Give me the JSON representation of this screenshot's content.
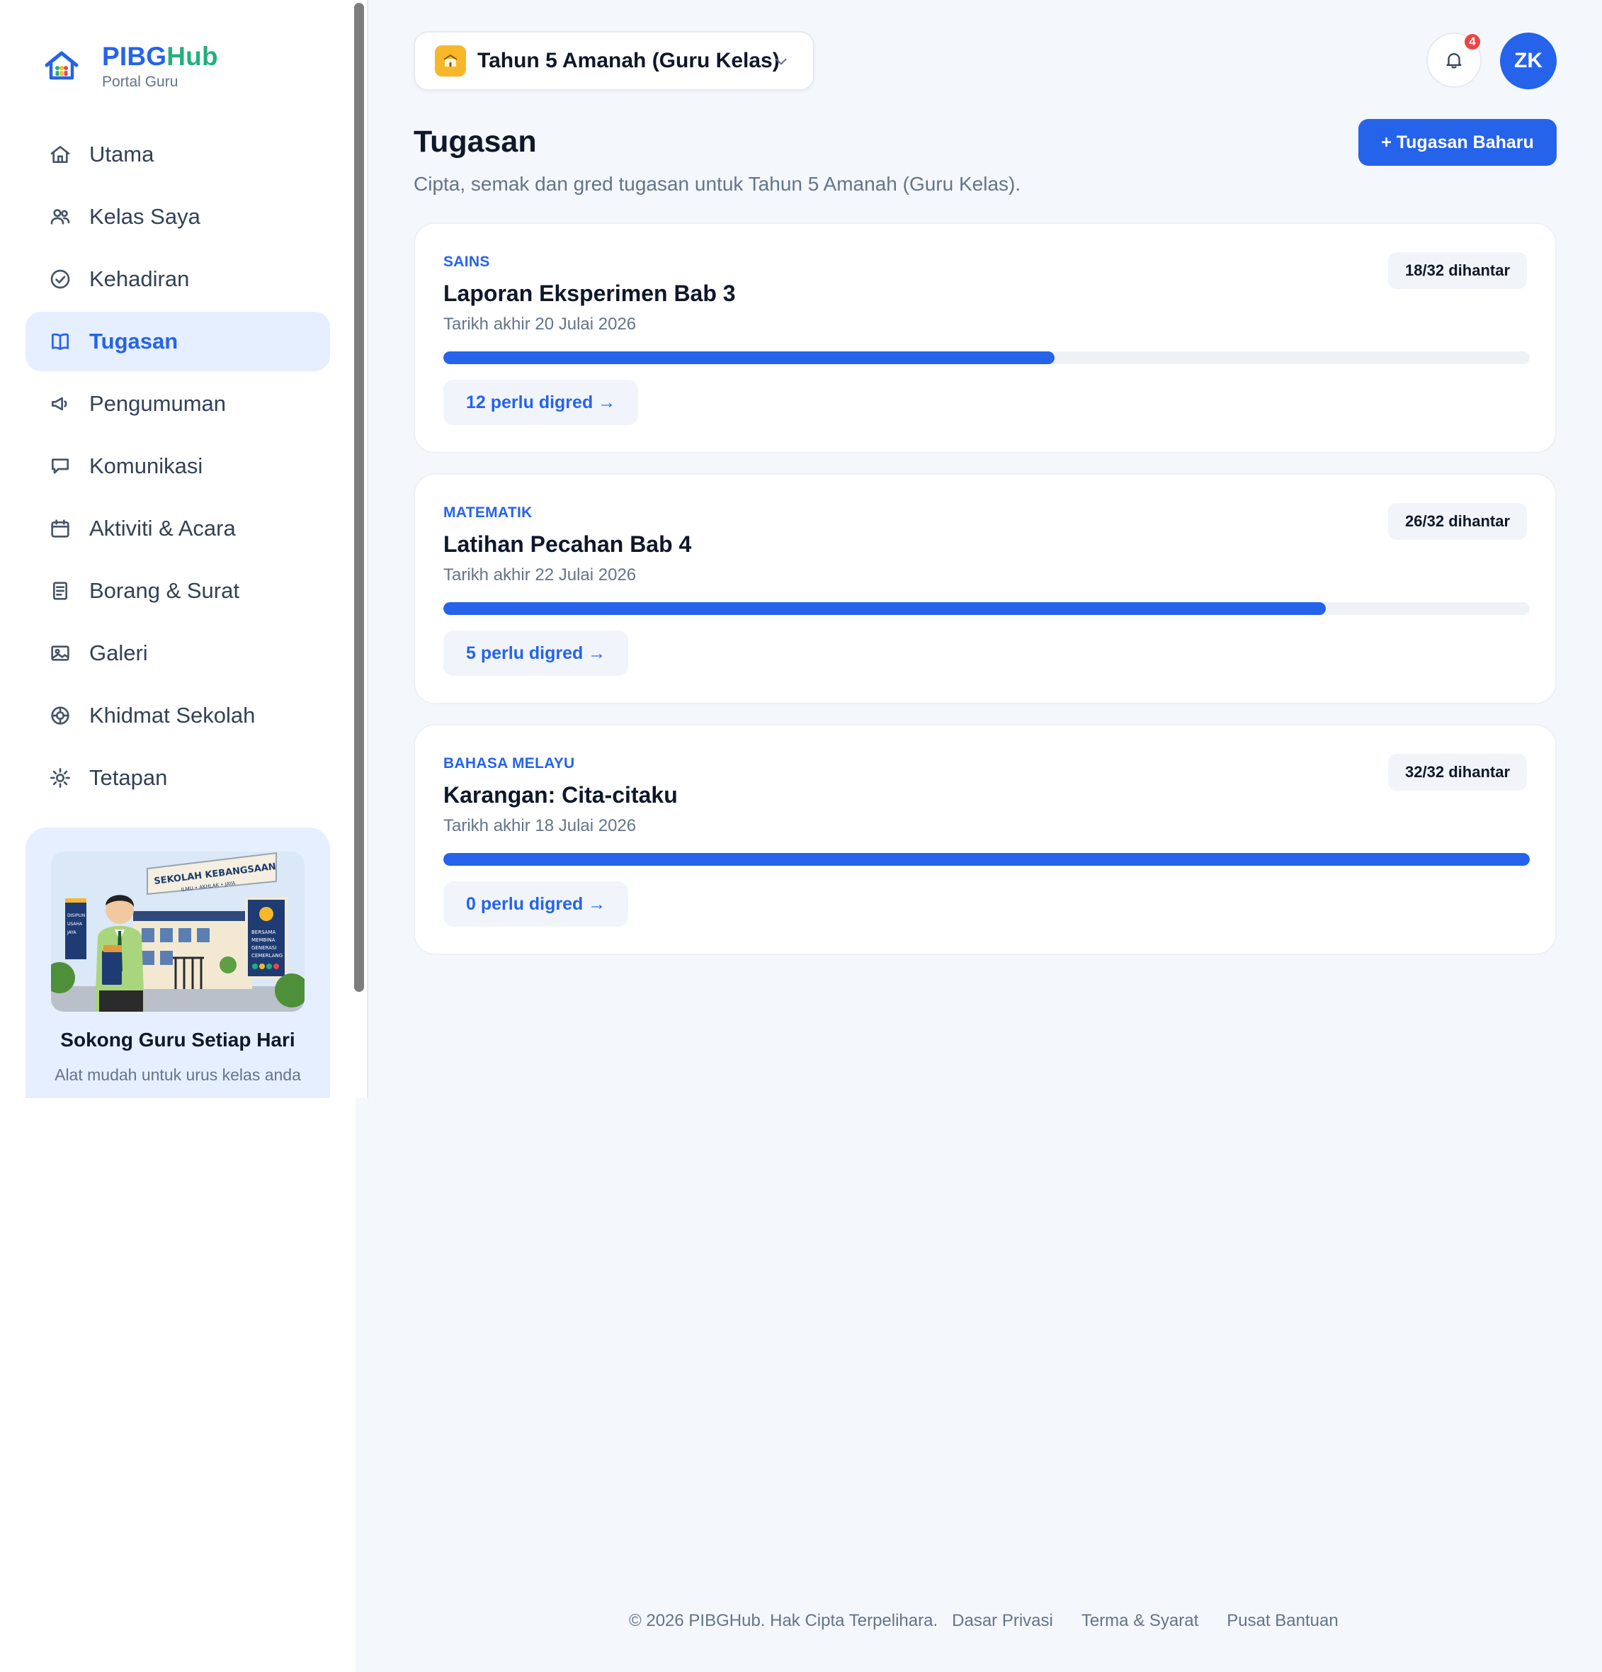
{
  "brand": {
    "name_part1": "PIBG",
    "name_part2": "Hub",
    "subtitle": "Portal Guru"
  },
  "sidebar": {
    "items": [
      {
        "label": "Utama",
        "icon": "home-icon"
      },
      {
        "label": "Kelas Saya",
        "icon": "users-icon"
      },
      {
        "label": "Kehadiran",
        "icon": "check-circle-icon"
      },
      {
        "label": "Tugasan",
        "icon": "book-icon",
        "active": true
      },
      {
        "label": "Pengumuman",
        "icon": "megaphone-icon"
      },
      {
        "label": "Komunikasi",
        "icon": "chat-icon"
      },
      {
        "label": "Aktiviti & Acara",
        "icon": "calendar-icon"
      },
      {
        "label": "Borang & Surat",
        "icon": "document-icon"
      },
      {
        "label": "Galeri",
        "icon": "image-icon"
      },
      {
        "label": "Khidmat Sekolah",
        "icon": "lifebuoy-icon"
      },
      {
        "label": "Tetapan",
        "icon": "settings-icon"
      }
    ],
    "promo": {
      "title": "Sokong Guru Setiap Hari",
      "subtitle": "Alat mudah untuk urus kelas anda",
      "art_text": {
        "sign": "SEKOLAH KEBANGSAAN",
        "motto": "ILMU • AKHLAK • JAYA",
        "banner_left": [
          "DISIPLIN",
          "USAHA",
          "JAYA"
        ],
        "banner_right": [
          "BERSAMA",
          "MEMBINA",
          "GENERASI",
          "CEMERLANG"
        ]
      }
    }
  },
  "header": {
    "class_selector": "Tahun 5 Amanah (Guru Kelas)",
    "notification_count": "4",
    "avatar_initials": "ZK"
  },
  "page": {
    "title": "Tugasan",
    "subtitle": "Cipta, semak dan gred tugasan untuk Tahun 5 Amanah (Guru Kelas).",
    "new_button": "+ Tugasan Baharu"
  },
  "assignments": [
    {
      "subject": "SAINS",
      "title": "Laporan Eksperimen Bab 3",
      "due": "Tarikh akhir 20 Julai 2026",
      "submitted": "18/32 dihantar",
      "progress": 0.5625,
      "grade_label": "12 perlu digred →"
    },
    {
      "subject": "MATEMATIK",
      "title": "Latihan Pecahan Bab 4",
      "due": "Tarikh akhir 22 Julai 2026",
      "submitted": "26/32 dihantar",
      "progress": 0.8125,
      "grade_label": "5 perlu digred →"
    },
    {
      "subject": "BAHASA MELAYU",
      "title": "Karangan: Cita-citaku",
      "due": "Tarikh akhir 18 Julai 2026",
      "submitted": "32/32 dihantar",
      "progress": 1.0,
      "grade_label": "0 perlu digred →"
    }
  ],
  "footer": {
    "copyright": "© 2026 PIBGHub. Hak Cipta Terpelihara.",
    "links": [
      "Dasar Privasi",
      "Terma & Syarat",
      "Pusat Bantuan"
    ]
  },
  "colors": {
    "primary": "#2563eb",
    "brand_green": "#22b07d",
    "badge_red": "#ef4444",
    "class_badge": "#f6b829"
  }
}
